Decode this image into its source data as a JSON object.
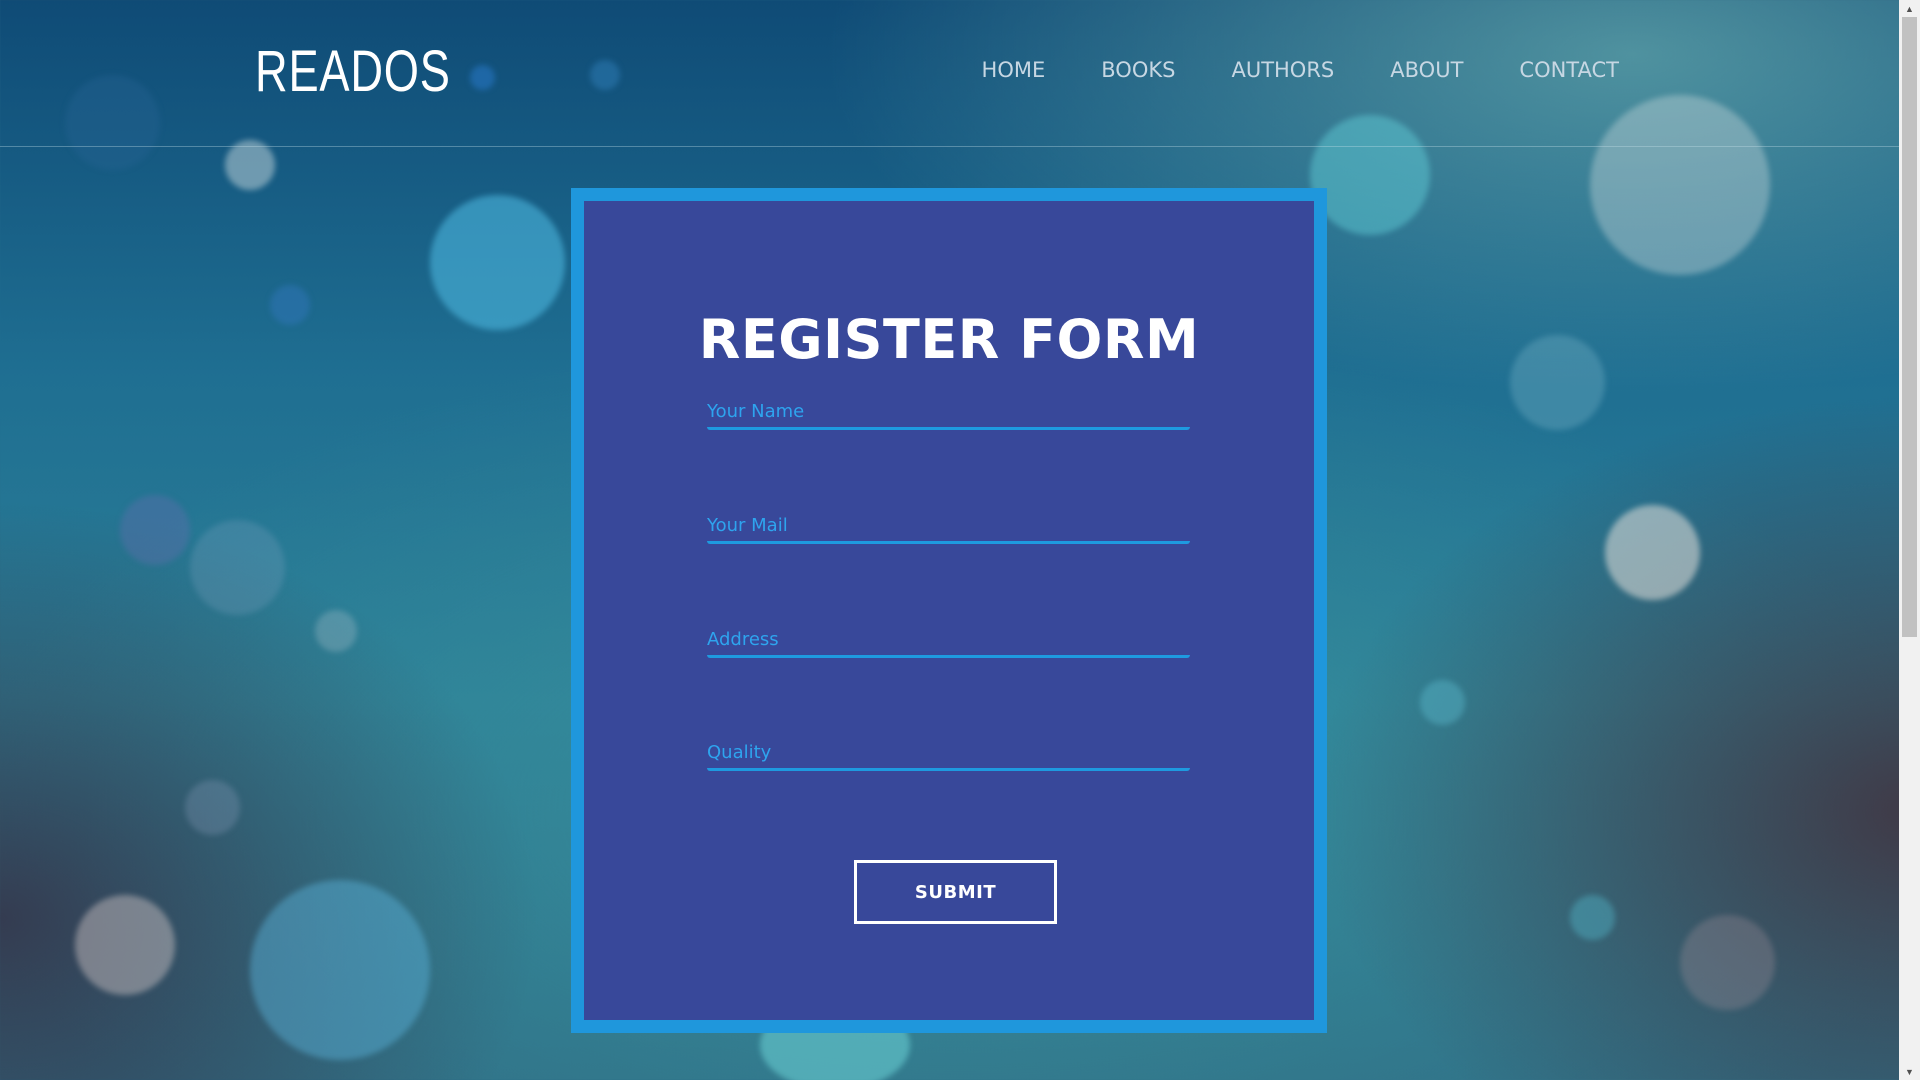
{
  "header": {
    "logo": "READOS",
    "nav": [
      "HOME",
      "BOOKS",
      "AUTHORS",
      "ABOUT",
      "CONTACT"
    ]
  },
  "form": {
    "title": "REGISTER FORM",
    "fields": [
      {
        "placeholder": "Your Name",
        "value": ""
      },
      {
        "placeholder": "Your Mail",
        "value": ""
      },
      {
        "placeholder": "Address",
        "value": ""
      },
      {
        "placeholder": "Quality",
        "value": ""
      }
    ],
    "submit_label": "SUBMIT"
  },
  "colors": {
    "card_background": "#38489a",
    "card_border": "#1f97dc",
    "field_accent": "#2ea4ee",
    "text_white": "#ffffff",
    "nav_text": "#c7d7e3"
  },
  "icons": {
    "scroll_up": "triangle-up-icon",
    "scroll_down": "triangle-down-icon"
  }
}
